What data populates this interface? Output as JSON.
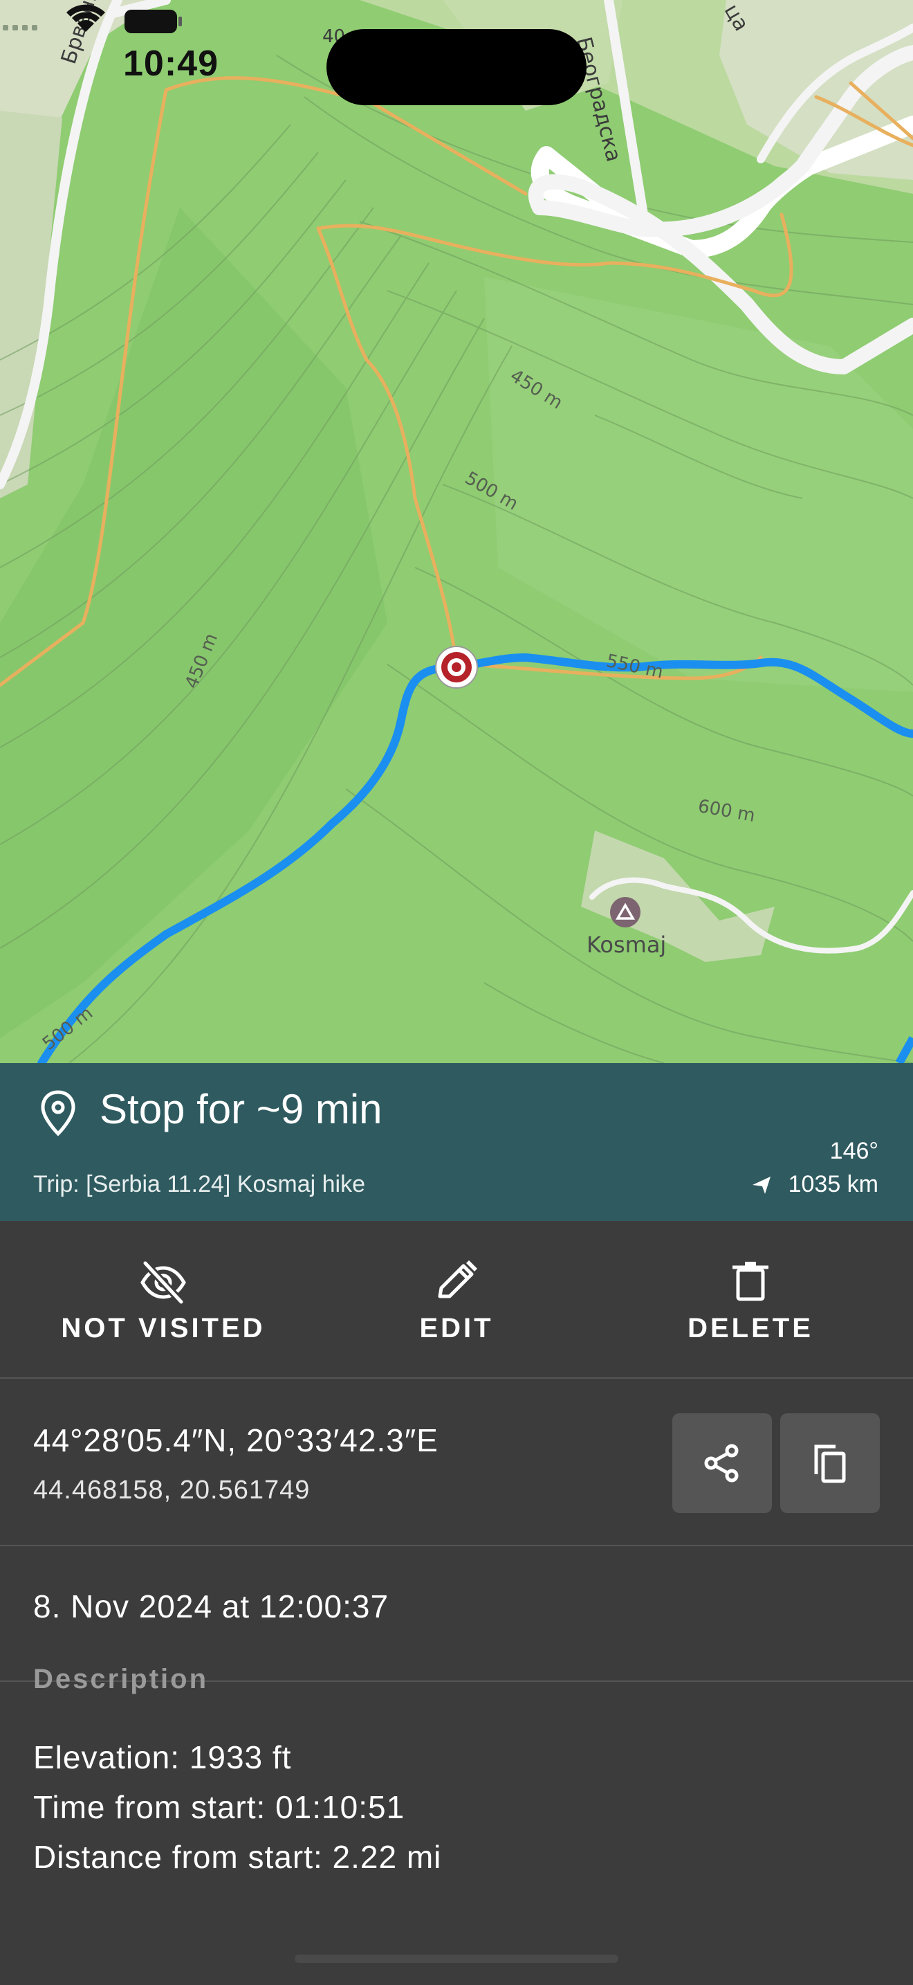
{
  "status_bar": {
    "time": "10:49"
  },
  "map": {
    "contour_labels": [
      "450 m",
      "500 m",
      "450 m",
      "550 m",
      "600 m",
      "500 m"
    ],
    "streets": [
      "Брвеничка",
      "Београдска",
      "40",
      "ца"
    ],
    "poi": {
      "name": "Kosmaj",
      "icon": "peak-icon"
    },
    "colors": {
      "terrain": "#8fcc72",
      "track": "#1e90ff",
      "path": "#f2a94a",
      "road": "#f5f5f5",
      "marker": "#b52229"
    }
  },
  "header": {
    "title": "Stop for ~9 min",
    "icon": "location-pin-icon",
    "trip": "Trip: [Serbia 11.24] Kosmaj hike",
    "bearing": "146°",
    "distance": "1035 km",
    "direction_icon": "navigation-arrow-icon",
    "background": "#2f5b60"
  },
  "actions": [
    {
      "label": "NOT VISITED",
      "icon": "eye-off-icon"
    },
    {
      "label": "EDIT",
      "icon": "pencil-icon"
    },
    {
      "label": "DELETE",
      "icon": "trash-icon"
    }
  ],
  "coordinates": {
    "dms": "44°28′05.4″N, 20°33′42.3″E",
    "decimal": "44.468158, 20.561749",
    "share_icon": "share-icon",
    "copy_icon": "copy-icon"
  },
  "details": {
    "datetime": "8. Nov 2024 at 12:00:37",
    "description_heading": "Description",
    "description_lines": [
      "Elevation: 1933 ft",
      "Time from start: 01:10:51",
      "Distance from start: 2.22 mi"
    ]
  }
}
